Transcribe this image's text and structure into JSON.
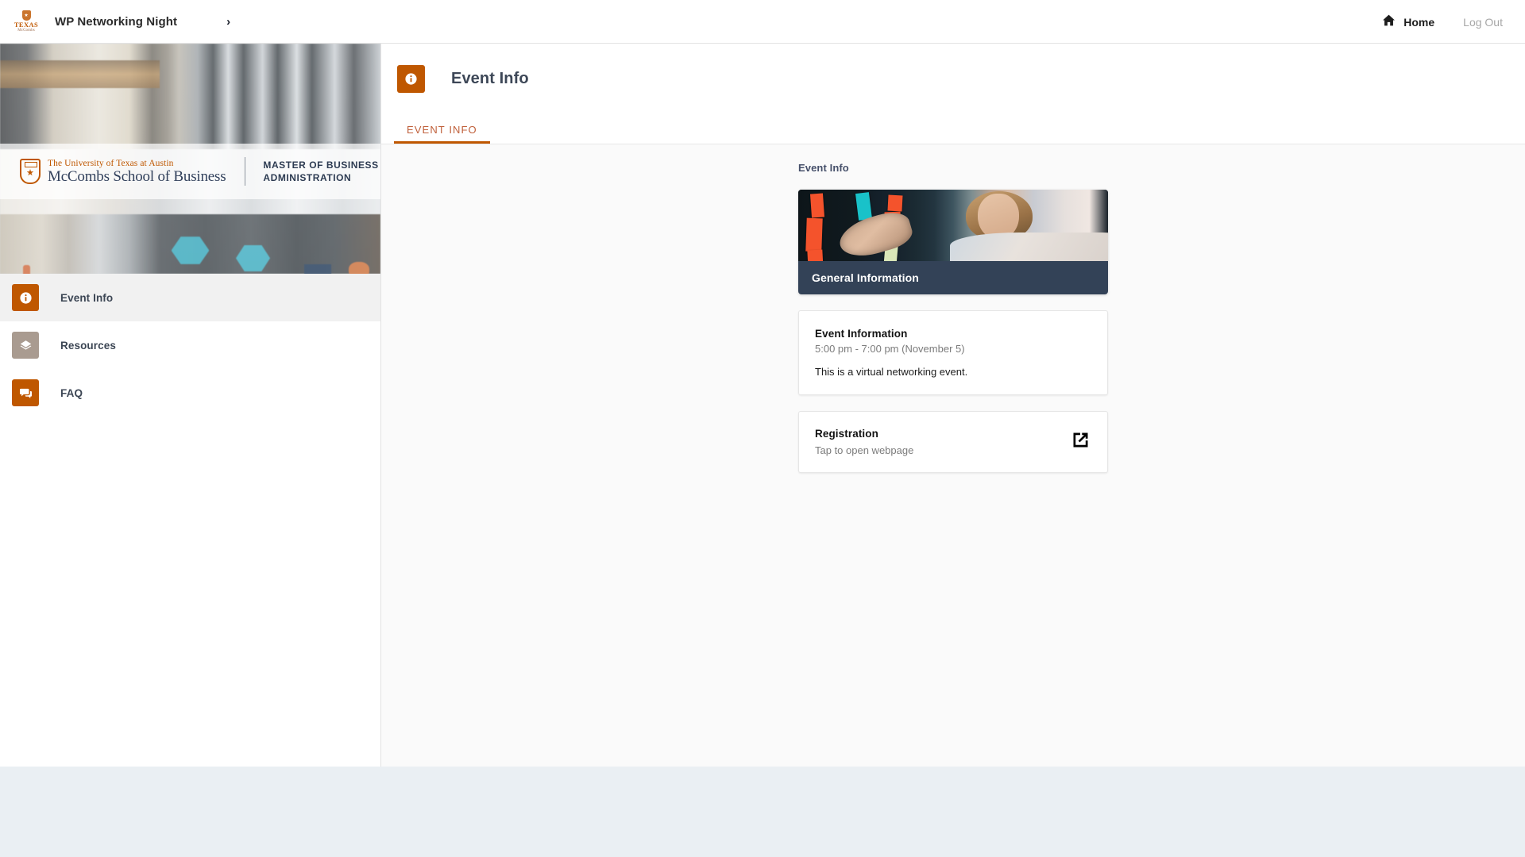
{
  "topbar": {
    "logo_name": "texas-mccombs-logo",
    "event_title": "WP Networking Night",
    "expand_chevron": "›",
    "home_label": "Home",
    "logout_label": "Log Out"
  },
  "banner": {
    "university_line": "The University of Texas at Austin",
    "school_line": "McCombs School of Business",
    "program_line1": "MASTER OF BUSINESS",
    "program_line2": "ADMINISTRATION"
  },
  "sidebar": {
    "items": [
      {
        "label": "Event Info",
        "icon": "info-icon",
        "icon_color": "#bf5700",
        "active": true
      },
      {
        "label": "Resources",
        "icon": "layers-icon",
        "icon_color": "#a99b90",
        "active": false
      },
      {
        "label": "FAQ",
        "icon": "chat-icon",
        "icon_color": "#bf5700",
        "active": false
      }
    ]
  },
  "page": {
    "icon": "info-icon",
    "title": "Event Info",
    "tabs": [
      {
        "label": "EVENT INFO",
        "active": true
      }
    ],
    "section_label": "Event Info"
  },
  "general_information": {
    "photo_alt": "woman placing sticky notes on glass board",
    "caption": "General Information"
  },
  "event_information": {
    "title": "Event Information",
    "time": "5:00 pm - 7:00 pm (November 5)",
    "description": "This is a virtual networking event."
  },
  "registration": {
    "title": "Registration",
    "subtitle": "Tap to open webpage",
    "icon": "open-in-new-icon"
  },
  "colors": {
    "accent_orange": "#bf5700",
    "tab_text": "#c0603b",
    "caption_navy": "#334257",
    "taupe": "#a99b90",
    "page_background": "#eaeff3",
    "content_background": "#fafafa"
  }
}
